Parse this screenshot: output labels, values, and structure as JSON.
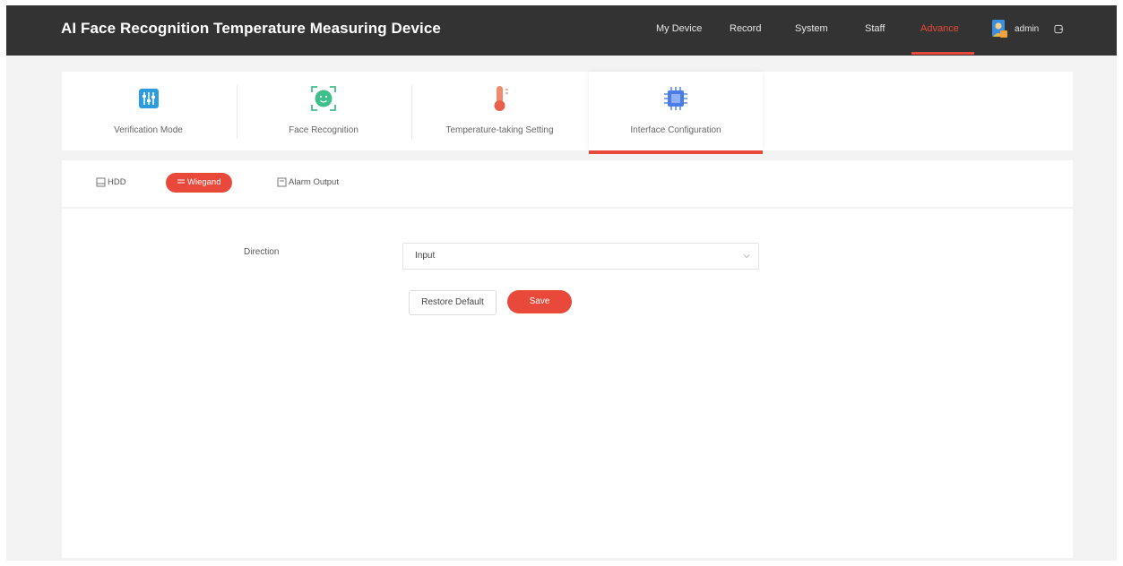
{
  "app": {
    "title": "AI Face Recognition Temperature Measuring Device"
  },
  "nav": {
    "items": [
      {
        "label": "My Device"
      },
      {
        "label": "Record"
      },
      {
        "label": "System"
      },
      {
        "label": "Staff"
      },
      {
        "label": "Advance"
      }
    ],
    "active": "Advance",
    "user": "admin"
  },
  "categories": [
    {
      "label": "Verification Mode",
      "icon": "sliders-icon"
    },
    {
      "label": "Face Recognition",
      "icon": "face-scan-icon"
    },
    {
      "label": "Temperature-taking Setting",
      "icon": "thermometer-icon"
    },
    {
      "label": "Interface Configuration",
      "icon": "chip-icon"
    }
  ],
  "active_category": "Interface Configuration",
  "subtabs": [
    {
      "label": "HDD",
      "icon": "hdd-icon"
    },
    {
      "label": "Wiegand",
      "icon": "wiegand-icon"
    },
    {
      "label": "Alarm Output",
      "icon": "alarm-output-icon"
    }
  ],
  "active_subtab": "Wiegand",
  "form": {
    "direction_label": "Direction",
    "direction_value": "Input"
  },
  "buttons": {
    "restore": "Restore Default",
    "save": "Save"
  },
  "colors": {
    "accent": "#e8493a",
    "topbar": "#333333",
    "background": "#f3f3f3"
  }
}
